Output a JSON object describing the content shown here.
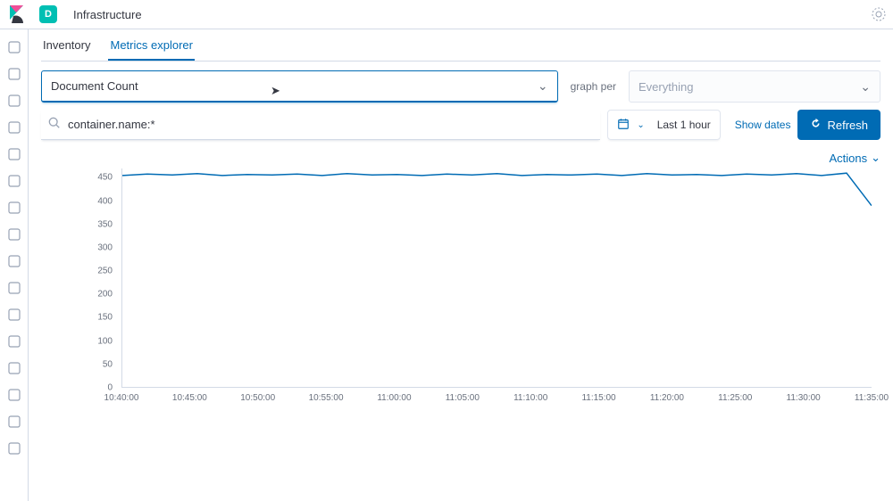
{
  "header": {
    "space_initial": "D",
    "app_title": "Infrastructure"
  },
  "tabs": {
    "inventory": "Inventory",
    "metrics_explorer": "Metrics explorer"
  },
  "controls": {
    "metric_value": "Document Count",
    "graph_per_label": "graph per",
    "group_placeholder": "Everything",
    "search_value": "container.name:*",
    "time_range": "Last 1 hour",
    "show_dates": "Show dates",
    "refresh_label": "Refresh",
    "actions_label": "Actions"
  },
  "colors": {
    "primary": "#006bb4",
    "accent": "#00bfb3"
  },
  "sidebar_icons": [
    "recent-icon",
    "discover-icon",
    "visualize-icon",
    "dashboard-icon",
    "canvas-icon",
    "maps-icon",
    "ml-icon",
    "infra-icon",
    "logs-icon",
    "apm-icon",
    "uptime-icon",
    "siem-icon",
    "dev-tools-icon",
    "monitoring-icon",
    "management-icon",
    "collapse-icon"
  ],
  "chart_data": {
    "type": "line",
    "title": "",
    "xlabel": "",
    "ylabel": "",
    "ylim": [
      0,
      470
    ],
    "y_ticks": [
      0,
      50,
      100,
      150,
      200,
      250,
      300,
      350,
      400,
      450
    ],
    "x_ticks": [
      "10:40:00",
      "10:45:00",
      "10:50:00",
      "10:55:00",
      "11:00:00",
      "11:05:00",
      "11:10:00",
      "11:15:00",
      "11:20:00",
      "11:25:00",
      "11:30:00",
      "11:35:00"
    ],
    "series": [
      {
        "name": "Document Count",
        "color": "#006bb4",
        "x": [
          "10:38",
          "10:40",
          "10:42",
          "10:44",
          "10:46",
          "10:48",
          "10:50",
          "10:52",
          "10:54",
          "10:56",
          "10:58",
          "11:00",
          "11:02",
          "11:04",
          "11:06",
          "11:08",
          "11:10",
          "11:12",
          "11:14",
          "11:16",
          "11:18",
          "11:20",
          "11:22",
          "11:24",
          "11:26",
          "11:28",
          "11:30",
          "11:32",
          "11:34",
          "11:36",
          "11:38"
        ],
        "values": [
          455,
          458,
          456,
          459,
          455,
          457,
          456,
          458,
          455,
          459,
          456,
          457,
          455,
          458,
          456,
          459,
          455,
          457,
          456,
          458,
          455,
          459,
          456,
          457,
          455,
          458,
          456,
          459,
          455,
          460,
          390
        ]
      }
    ]
  }
}
